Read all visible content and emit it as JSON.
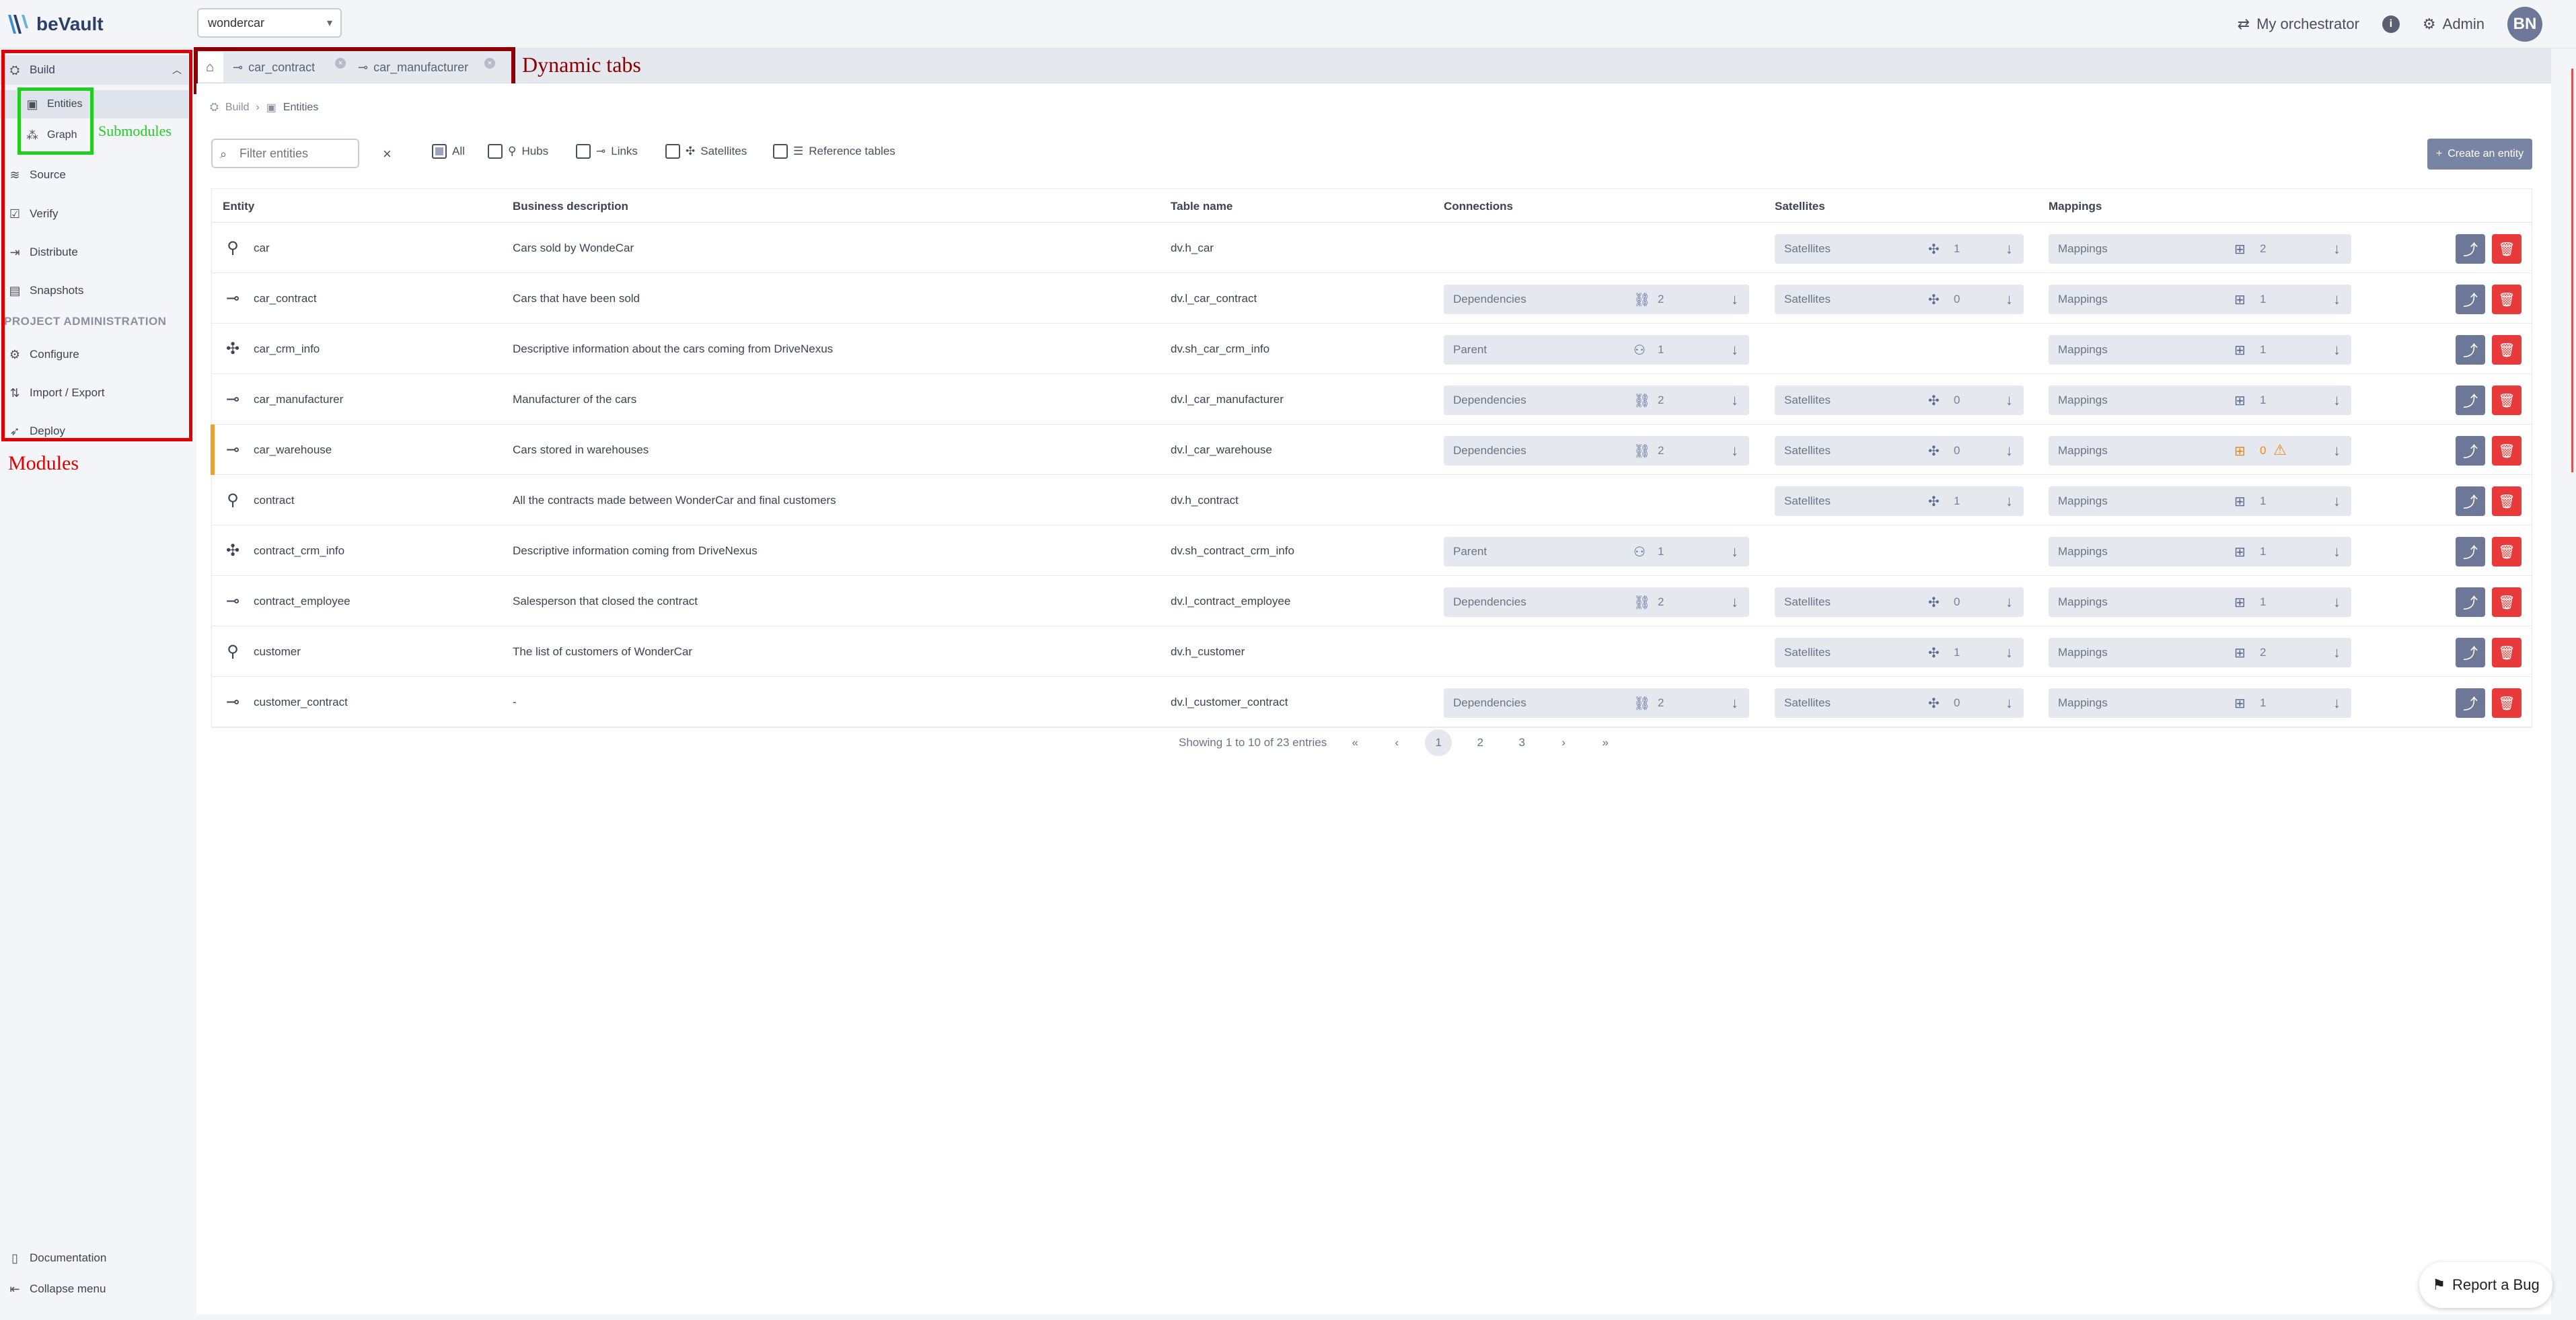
{
  "app": {
    "name": "beVault"
  },
  "project": {
    "selected": "wondercar"
  },
  "topbar": {
    "orchestrator": "My orchestrator",
    "admin": "Admin",
    "avatar": "BN"
  },
  "sidebar": {
    "build": "Build",
    "submodules": [
      {
        "label": "Entities"
      },
      {
        "label": "Graph"
      }
    ],
    "items": [
      {
        "label": "Source"
      },
      {
        "label": "Verify"
      },
      {
        "label": "Distribute"
      },
      {
        "label": "Snapshots"
      }
    ],
    "section_title": "PROJECT ADMINISTRATION",
    "admin_items": [
      {
        "label": "Configure"
      },
      {
        "label": "Import / Export"
      },
      {
        "label": "Deploy"
      }
    ],
    "bottom": [
      {
        "label": "Documentation"
      },
      {
        "label": "Collapse menu"
      }
    ]
  },
  "annotations": {
    "modules": "Modules",
    "submodules": "Submodules",
    "dynamic_tabs": "Dynamic tabs"
  },
  "tabs": [
    {
      "label": "car_contract"
    },
    {
      "label": "car_manufacturer"
    }
  ],
  "breadcrumb": {
    "root": "Build",
    "current": "Entities"
  },
  "filter": {
    "placeholder": "Filter entities"
  },
  "type_filters": [
    {
      "label": "All",
      "checked": true
    },
    {
      "label": "Hubs",
      "checked": false
    },
    {
      "label": "Links",
      "checked": false
    },
    {
      "label": "Satellites",
      "checked": false
    },
    {
      "label": "Reference tables",
      "checked": false
    }
  ],
  "create_button": "Create an entity",
  "table": {
    "headers": [
      "Entity",
      "Business description",
      "Table name",
      "Connections",
      "Satellites",
      "Mappings"
    ],
    "rows": [
      {
        "entity": "car",
        "type": "hub",
        "description": "Cars sold by WondeCar",
        "table": "dv.h_car",
        "connections": null,
        "satellites": "1",
        "mappings": "2",
        "warn": false
      },
      {
        "entity": "car_contract",
        "type": "link",
        "description": "Cars that have been sold",
        "table": "dv.l_car_contract",
        "connections": {
          "label": "Dependencies",
          "count": "2"
        },
        "satellites": "0",
        "mappings": "1",
        "warn": false
      },
      {
        "entity": "car_crm_info",
        "type": "satellite",
        "description": "Descriptive information about the cars coming from DriveNexus",
        "table": "dv.sh_car_crm_info",
        "connections": {
          "label": "Parent",
          "count": "1"
        },
        "satellites": null,
        "mappings": "1",
        "warn": false
      },
      {
        "entity": "car_manufacturer",
        "type": "link",
        "description": "Manufacturer of the cars",
        "table": "dv.l_car_manufacturer",
        "connections": {
          "label": "Dependencies",
          "count": "2"
        },
        "satellites": "0",
        "mappings": "1",
        "warn": false
      },
      {
        "entity": "car_warehouse",
        "type": "link",
        "description": "Cars stored in warehouses",
        "table": "dv.l_car_warehouse",
        "connections": {
          "label": "Dependencies",
          "count": "2"
        },
        "satellites": "0",
        "mappings": "0",
        "warn": true
      },
      {
        "entity": "contract",
        "type": "hub",
        "description": "All the contracts made between WonderCar and final customers",
        "table": "dv.h_contract",
        "connections": null,
        "satellites": "1",
        "mappings": "1",
        "warn": false
      },
      {
        "entity": "contract_crm_info",
        "type": "satellite",
        "description": "Descriptive information coming from DriveNexus",
        "table": "dv.sh_contract_crm_info",
        "connections": {
          "label": "Parent",
          "count": "1"
        },
        "satellites": null,
        "mappings": "1",
        "warn": false
      },
      {
        "entity": "contract_employee",
        "type": "link",
        "description": "Salesperson that closed the contract",
        "table": "dv.l_contract_employee",
        "connections": {
          "label": "Dependencies",
          "count": "2"
        },
        "satellites": "0",
        "mappings": "1",
        "warn": false
      },
      {
        "entity": "customer",
        "type": "hub",
        "description": "The list of customers of WonderCar",
        "table": "dv.h_customer",
        "connections": null,
        "satellites": "1",
        "mappings": "2",
        "warn": false
      },
      {
        "entity": "customer_contract",
        "type": "link",
        "description": "-",
        "table": "dv.l_customer_contract",
        "connections": {
          "label": "Dependencies",
          "count": "2"
        },
        "satellites": "0",
        "mappings": "1",
        "warn": false
      }
    ],
    "satellites_label": "Satellites",
    "mappings_label": "Mappings"
  },
  "pagination": {
    "summary": "Showing 1 to 10 of 23 entries",
    "pages": [
      "1",
      "2",
      "3"
    ],
    "current": "1"
  },
  "report_bug": "Report a Bug",
  "colors": {
    "primary": "#6d7898",
    "danger": "#e83a3a",
    "warning": "#f0a030",
    "modules_annotation": "#e00000",
    "submodules_annotation": "#22cc22",
    "tabs_annotation": "#8b0000"
  }
}
